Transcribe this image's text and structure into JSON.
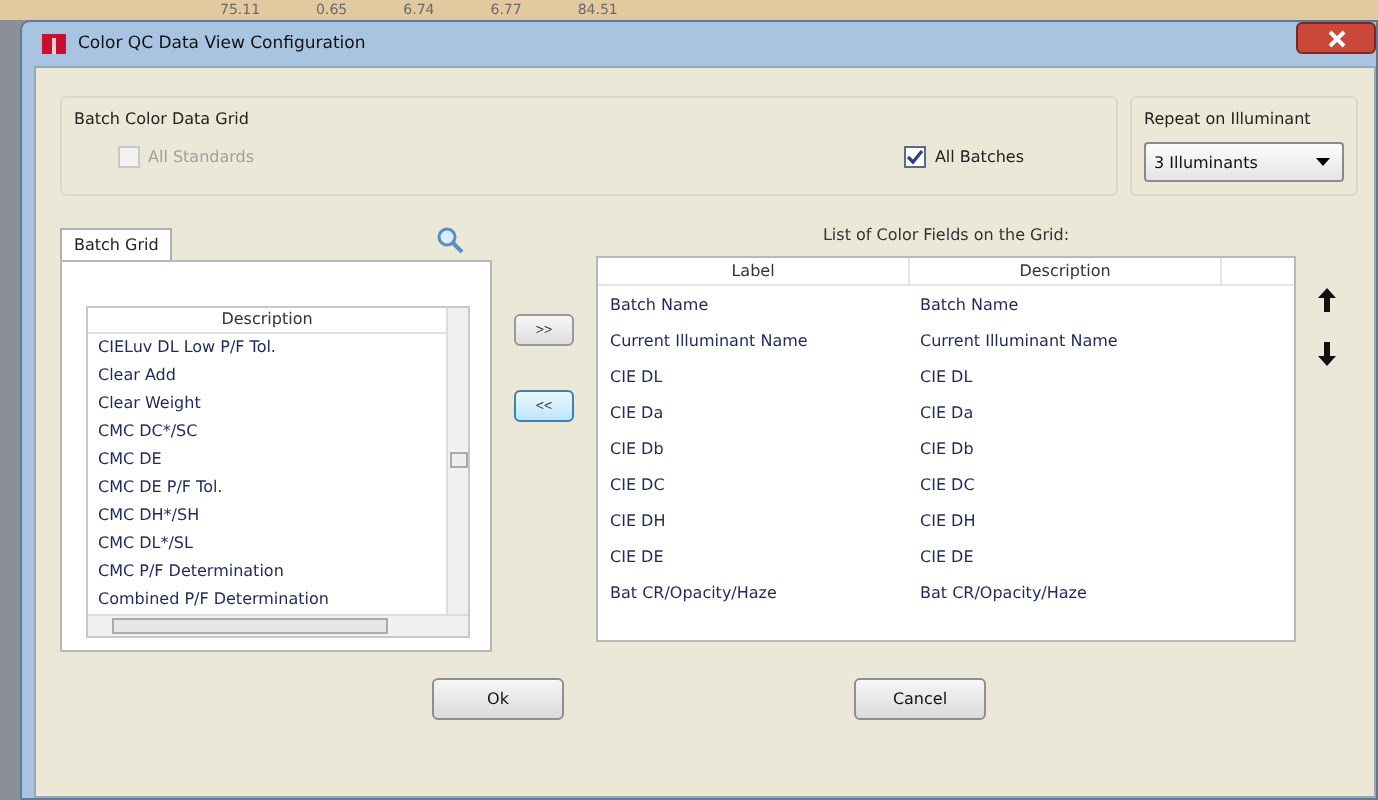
{
  "background_row": [
    "75.11",
    "0.65",
    "6.74",
    "6.77",
    "84.51"
  ],
  "window": {
    "title": "Color QC Data View Configuration"
  },
  "batch_group": {
    "title": "Batch Color Data Grid",
    "options": [
      {
        "label": "All Standards",
        "checked": false,
        "disabled": true
      },
      {
        "label": "All Batches",
        "checked": true,
        "disabled": false
      }
    ]
  },
  "repeat_group": {
    "title": "Repeat on Illuminant",
    "value": "3 Illuminants"
  },
  "tabs": [
    {
      "label": "Batch Grid",
      "selected": true
    }
  ],
  "available_list": {
    "columns": [
      "Description"
    ],
    "rows": [
      "CIELuv DL Low P/F Tol.",
      "Clear Add",
      "Clear Weight",
      "CMC DC*/SC",
      "CMC DE",
      "CMC DE P/F Tol.",
      "CMC DH*/SH",
      "CMC DL*/SL",
      "CMC P/F Determination",
      "Combined P/F Determination"
    ]
  },
  "move_buttons": [
    ">>",
    "<<"
  ],
  "fields_list": {
    "title": "List of Color Fields on the Grid:",
    "columns": [
      "Label",
      "Description"
    ],
    "rows": [
      [
        "Batch Name",
        "Batch Name"
      ],
      [
        "Current Illuminant Name",
        "Current Illuminant Name"
      ],
      [
        "CIE DL",
        "CIE DL"
      ],
      [
        "CIE Da",
        "CIE Da"
      ],
      [
        "CIE Db",
        "CIE Db"
      ],
      [
        "CIE DC",
        "CIE DC"
      ],
      [
        "CIE DH",
        "CIE DH"
      ],
      [
        "CIE DE",
        "CIE DE"
      ],
      [
        "Bat CR/Opacity/Haze",
        "Bat CR/Opacity/Haze"
      ]
    ]
  },
  "buttons": [
    "Ok",
    "Cancel"
  ]
}
